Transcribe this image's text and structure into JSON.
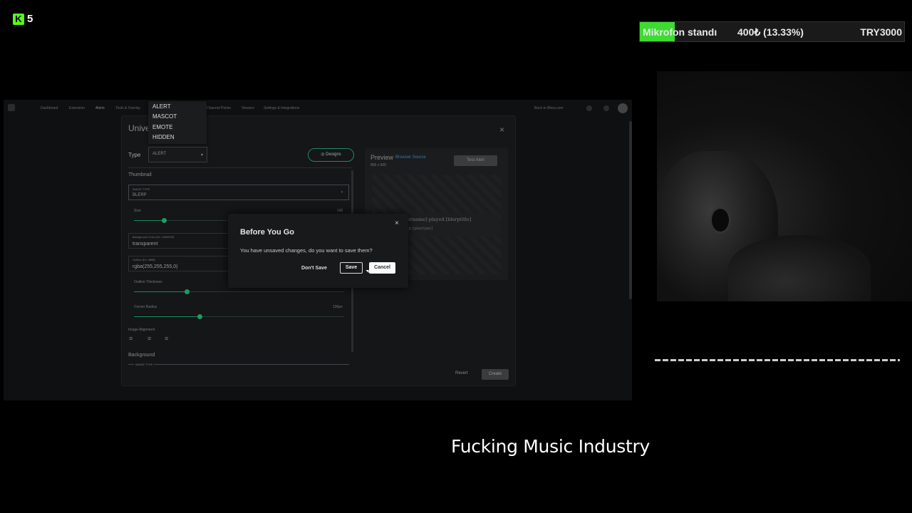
{
  "overlay": {
    "logo_letter": "K",
    "logo_number": "5",
    "goal": {
      "title": "Mikrofon standı",
      "amount": "400₺ (13.33%)",
      "target": "TRY3000",
      "progress_percent": 13.33,
      "fill_color": "#3ddc30"
    },
    "now_playing": "Fucking Music Industry"
  },
  "screen": {
    "nav": {
      "items": [
        "Dashboard",
        "Extension",
        "Alerts",
        "Tools & Overlay",
        "Channel Points",
        "Viewers",
        "Settings & Integrations"
      ],
      "back_link": "Back to Blerp.com"
    },
    "modal": {
      "title": "Unive",
      "close": "×",
      "type_label": "Type",
      "type_value": "ALERT",
      "type_arrow": "▾",
      "designs_label": "Designs",
      "thumbnail_label": "Thumbnail",
      "image_type_label": "IMAGE TYPE",
      "image_type_value": "BLERP",
      "size_label": "Size",
      "size_value": "142",
      "bg_label": "Background Color (Ex. #000000)",
      "bg_value": "transparent",
      "outline_label": "Outline (Ex. #ffffff)",
      "outline_value": "rgba(255,255,255,0)",
      "outline_thickness_label": "Outline Thickness",
      "corner_radius_label": "Corner Radius",
      "corner_radius_value": "100px",
      "image_alignment_label": "Image Alignment",
      "background_label": "Background",
      "bottom_image_type_label": "IMAGE TYPE",
      "preview_label": "Preview",
      "preview_link": "Browser Source",
      "preview_size": "800 x 600",
      "test_alert": "Test Alert",
      "preview_line1": "[username] played [blerptitle]",
      "preview_line2": "Blerp [playtype]",
      "revert": "Revert",
      "create": "Create"
    },
    "dropdown": {
      "options": [
        "ALERT",
        "MASCOT",
        "EMOTE",
        "HIDDEN"
      ]
    },
    "dialog": {
      "title": "Before You Go",
      "close": "×",
      "message": "You have unsaved changes, do you want to save them?",
      "dont_save": "Don't Save",
      "save": "Save",
      "cancel": "Cancel"
    }
  }
}
